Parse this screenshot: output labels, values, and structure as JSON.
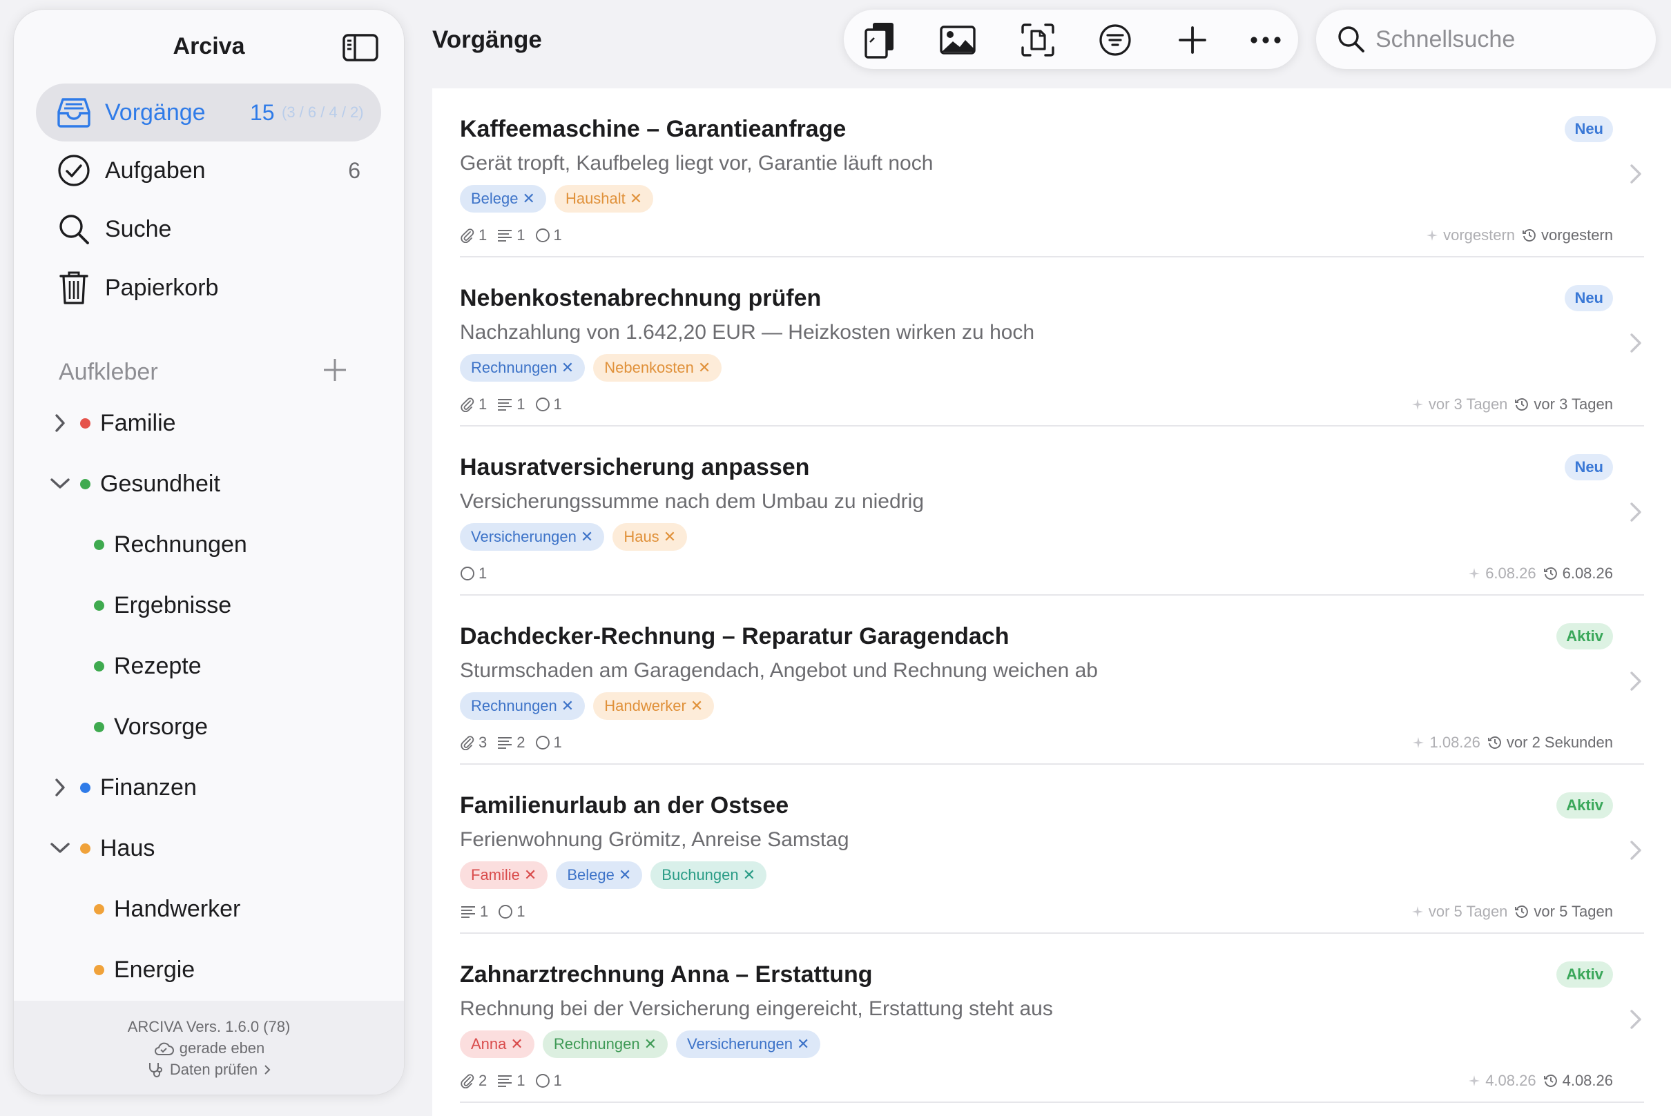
{
  "sidebar": {
    "app_title": "Arciva",
    "nav": [
      {
        "label": "Vorgänge",
        "count": "15",
        "sub": "(3 / 6 / 4 / 2)"
      },
      {
        "label": "Aufgaben",
        "count": "6"
      },
      {
        "label": "Suche"
      },
      {
        "label": "Papierkorb"
      }
    ],
    "stickers_heading": "Aufkleber",
    "tree": [
      {
        "label": "Familie",
        "color": "#e5534b"
      },
      {
        "label": "Gesundheit",
        "color": "#3faa4f"
      },
      {
        "label": "Rechnungen",
        "color": "#3faa4f"
      },
      {
        "label": "Ergebnisse",
        "color": "#3faa4f"
      },
      {
        "label": "Rezepte",
        "color": "#3faa4f"
      },
      {
        "label": "Vorsorge",
        "color": "#3faa4f"
      },
      {
        "label": "Finanzen",
        "color": "#2f7be8"
      },
      {
        "label": "Haus",
        "color": "#f0a23a"
      },
      {
        "label": "Handwerker",
        "color": "#f0a23a"
      },
      {
        "label": "Energie",
        "color": "#f0a23a"
      }
    ],
    "footer": {
      "version": "ARCIVA  Vers. 1.6.0 (78)",
      "sync": "gerade eben",
      "check": "Daten prüfen"
    }
  },
  "header": {
    "title": "Vorgänge",
    "search_placeholder": "Schnellsuche"
  },
  "cards": [
    {
      "title": "Kaffeemaschine – Garantieanfrage",
      "desc": "Gerät tropft, Kaufbeleg liegt vor, Garantie läuft noch",
      "badge": "Neu",
      "tags": [
        "Belege",
        "Haushalt"
      ],
      "meta": [
        "1",
        "1",
        "1"
      ],
      "created": "vorgestern",
      "modified": "vorgestern"
    },
    {
      "title": "Nebenkostenabrechnung prüfen",
      "desc": "Nachzahlung von 1.642,20 EUR — Heizkosten wirken zu hoch",
      "badge": "Neu",
      "tags": [
        "Rechnungen",
        "Nebenkosten"
      ],
      "meta": [
        "1",
        "1",
        "1"
      ],
      "created": "vor 3 Tagen",
      "modified": "vor 3 Tagen"
    },
    {
      "title": "Hausratversicherung anpassen",
      "desc": "Versicherungssumme nach dem Umbau zu niedrig",
      "badge": "Neu",
      "tags": [
        "Versicherungen",
        "Haus"
      ],
      "meta": [
        "1"
      ],
      "created": "6.08.26",
      "modified": "6.08.26"
    },
    {
      "title": "Dachdecker-Rechnung – Reparatur Garagendach",
      "desc": "Sturmschaden am Garagendach, Angebot und Rechnung weichen ab",
      "badge": "Aktiv",
      "tags": [
        "Rechnungen",
        "Handwerker"
      ],
      "meta": [
        "3",
        "2",
        "1"
      ],
      "created": "1.08.26",
      "modified": "vor 2 Sekunden"
    },
    {
      "title": "Familienurlaub an der Ostsee",
      "desc": "Ferienwohnung Grömitz, Anreise Samstag",
      "badge": "Aktiv",
      "tags": [
        "Familie",
        "Belege",
        "Buchungen"
      ],
      "meta": [
        "1",
        "1"
      ],
      "created": "vor 5 Tagen",
      "modified": "vor 5 Tagen"
    },
    {
      "title": "Zahnarztrechnung Anna – Erstattung",
      "desc": "Rechnung bei der Versicherung eingereicht, Erstattung steht aus",
      "badge": "Aktiv",
      "tags": [
        "Anna",
        "Rechnungen",
        "Versicherungen"
      ],
      "meta": [
        "2",
        "1",
        "1"
      ],
      "created": "4.08.26",
      "modified": "4.08.26"
    }
  ]
}
